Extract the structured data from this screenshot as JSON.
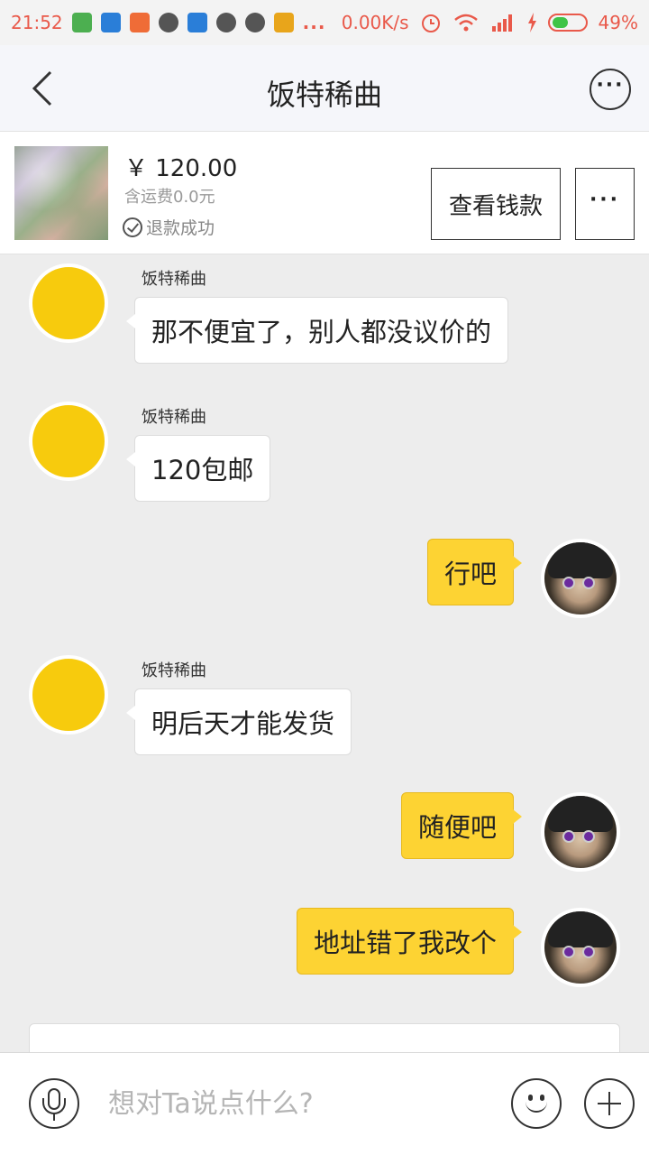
{
  "status_bar": {
    "time": "21:52",
    "dots": "...",
    "net_speed": "0.00K/s",
    "battery": "49%",
    "battery_level": 0.49,
    "colors": {
      "status_text": "#e9594a",
      "battery_fill": "#3ec447"
    }
  },
  "header": {
    "title": "饭特稀曲",
    "back_icon": "chevron-left-icon",
    "more_icon": "more-circle-icon"
  },
  "product": {
    "price": "￥ 120.00",
    "shipping": "含运费0.0元",
    "refund_status": "退款成功",
    "view_money_label": "查看钱款",
    "more_label": "···"
  },
  "messages": [
    {
      "side": "in",
      "sender": "饭特稀曲",
      "text": "那不便宜了，别人都没议价的"
    },
    {
      "side": "in",
      "sender": "饭特稀曲",
      "text": "120包邮"
    },
    {
      "side": "out",
      "text": "行吧"
    },
    {
      "side": "in",
      "sender": "饭特稀曲",
      "text": "明后天才能发货"
    },
    {
      "side": "out",
      "text": "随便吧"
    },
    {
      "side": "out",
      "text": "地址错了我改个"
    }
  ],
  "input_bar": {
    "placeholder": "想对Ta说点什么?",
    "value": ""
  },
  "colors": {
    "accent_yellow": "#fdd333",
    "avatar_yellow": "#f7cb0d",
    "chat_background": "#ededed"
  }
}
